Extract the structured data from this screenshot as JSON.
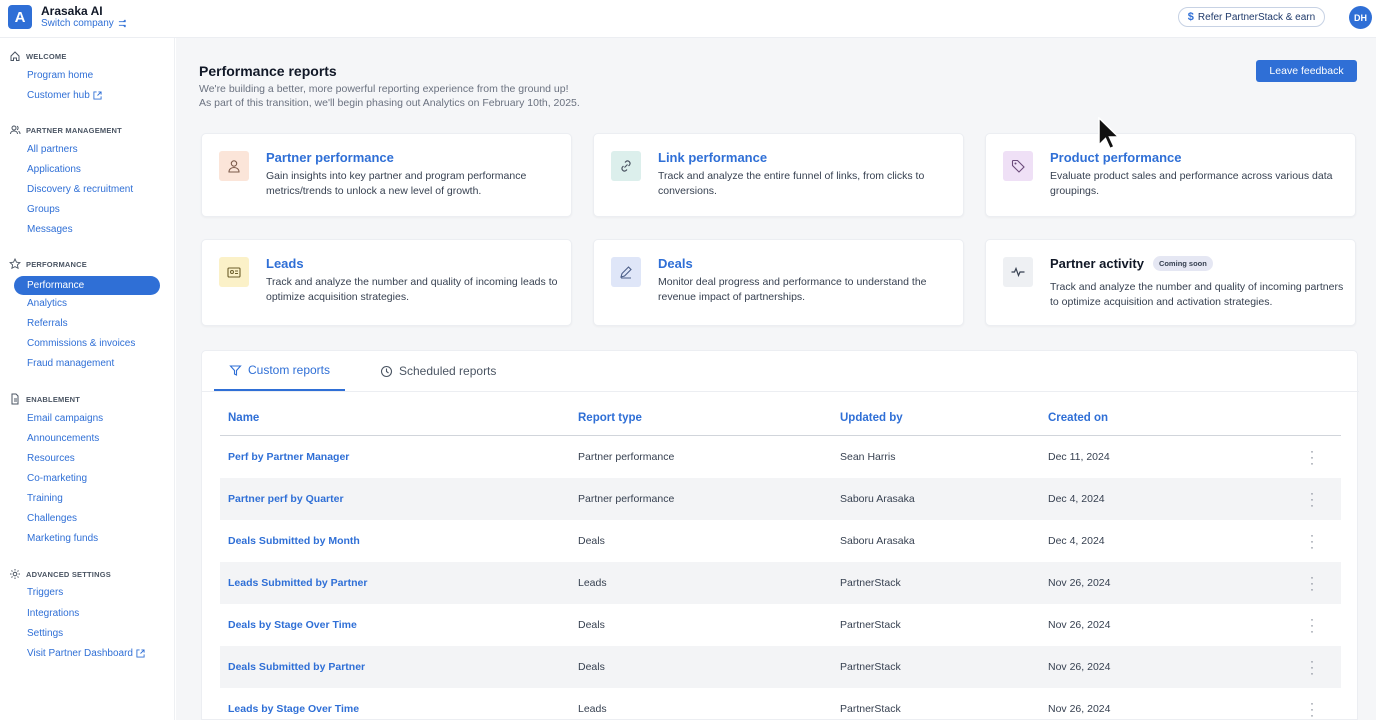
{
  "header": {
    "company_name": "Arasaka AI",
    "logo_letter": "A",
    "switch_label": "Switch company",
    "refer_label": "Refer PartnerStack & earn",
    "avatar_initials": "DH"
  },
  "sidebar": {
    "sections": [
      {
        "title": "WELCOME",
        "icon": "home-icon",
        "items": [
          "Program home",
          "Customer hub"
        ]
      },
      {
        "title": "PARTNER MANAGEMENT",
        "icon": "users-icon",
        "items": [
          "All partners",
          "Applications",
          "Discovery & recruitment",
          "Groups",
          "Messages"
        ]
      },
      {
        "title": "PERFORMANCE",
        "icon": "star-icon",
        "items": [
          "Performance",
          "Analytics",
          "Referrals",
          "Commissions & invoices",
          "Fraud management"
        ]
      },
      {
        "title": "ENABLEMENT",
        "icon": "document-icon",
        "items": [
          "Email campaigns",
          "Announcements",
          "Resources",
          "Co-marketing",
          "Training",
          "Challenges",
          "Marketing funds"
        ]
      },
      {
        "title": "ADVANCED SETTINGS",
        "icon": "gear-icon",
        "items": [
          "Triggers",
          "Integrations",
          "Settings",
          "Visit Partner Dashboard"
        ]
      }
    ],
    "active_item": "Performance"
  },
  "main": {
    "title": "Performance reports",
    "subtitle_line1": "We're building a better, more powerful reporting experience from the ground up!",
    "subtitle_line2": "As part of this transition, we'll begin phasing out Analytics on February 10th, 2025.",
    "feedback_label": "Leave feedback",
    "cards": [
      {
        "title": "Partner performance",
        "desc": "Gain insights into key partner and program performance metrics/trends to unlock a new level of growth.",
        "icon": "person-icon",
        "color": "#fbe5d9"
      },
      {
        "title": "Link performance",
        "desc": "Track and analyze the entire funnel of links, from clicks to conversions.",
        "icon": "link-icon",
        "color": "#dcefec"
      },
      {
        "title": "Product performance",
        "desc": "Evaluate product sales and performance across various data groupings.",
        "icon": "tag-icon",
        "color": "#efe0f6"
      },
      {
        "title": "Leads",
        "desc": "Track and analyze the number and quality of incoming leads to optimize acquisition strategies.",
        "icon": "lead-icon",
        "color": "#fbf1c8"
      },
      {
        "title": "Deals",
        "desc": "Monitor deal progress and performance to understand the revenue impact of partnerships.",
        "icon": "pencil-icon",
        "color": "#dfe6f8"
      },
      {
        "title": "Partner activity",
        "desc": "Track and analyze the number and quality of incoming partners to optimize acquisition and activation strategies.",
        "icon": "activity-icon",
        "color": "#eef0f3",
        "badge": "Coming soon"
      }
    ],
    "tabs": [
      "Custom reports",
      "Scheduled reports"
    ],
    "table": {
      "columns": [
        "Name",
        "Report type",
        "Updated by",
        "Created on"
      ],
      "rows": [
        [
          "Perf by Partner Manager",
          "Partner performance",
          "Sean Harris",
          "Dec 11, 2024"
        ],
        [
          "Partner perf by Quarter",
          "Partner performance",
          "Saboru Arasaka",
          "Dec 4, 2024"
        ],
        [
          "Deals Submitted by Month",
          "Deals",
          "Saboru Arasaka",
          "Dec 4, 2024"
        ],
        [
          "Leads Submitted by Partner",
          "Leads",
          "PartnerStack",
          "Nov 26, 2024"
        ],
        [
          "Deals by Stage Over Time",
          "Deals",
          "PartnerStack",
          "Nov 26, 2024"
        ],
        [
          "Deals Submitted by Partner",
          "Deals",
          "PartnerStack",
          "Nov 26, 2024"
        ],
        [
          "Leads by Stage Over Time",
          "Leads",
          "PartnerStack",
          "Nov 26, 2024"
        ]
      ]
    }
  }
}
